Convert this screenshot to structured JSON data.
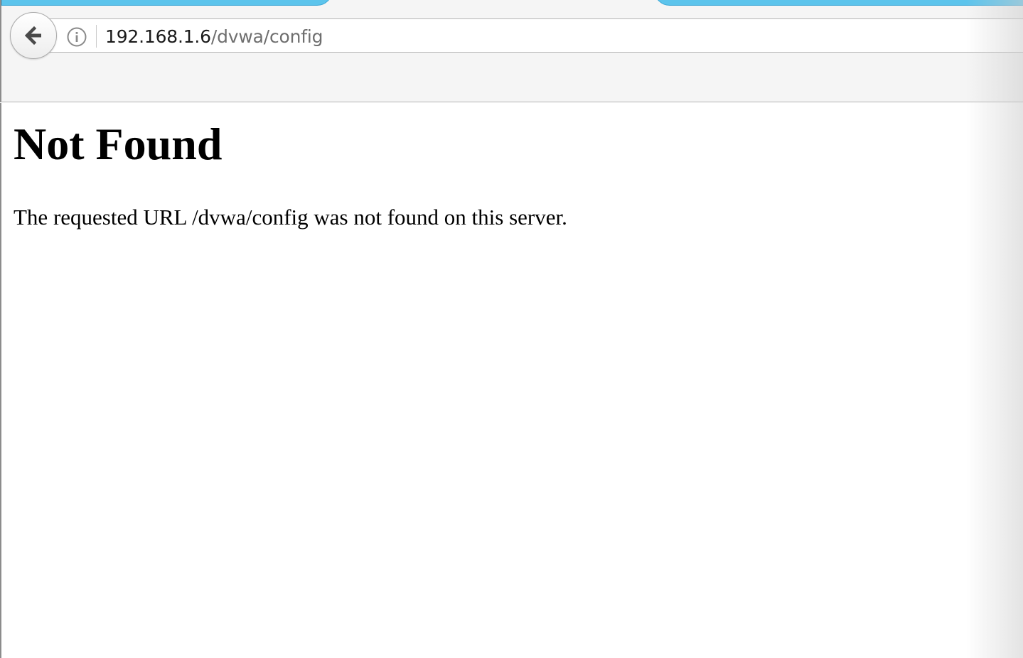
{
  "browser": {
    "url_host": "192.168.1.6",
    "url_path": "/dvwa/config",
    "tab_color": "#5cc4ec"
  },
  "page": {
    "title": "Not Found",
    "message": "The requested URL /dvwa/config was not found on this server."
  },
  "icons": {
    "back": "back-arrow-icon",
    "info": "info-icon"
  }
}
